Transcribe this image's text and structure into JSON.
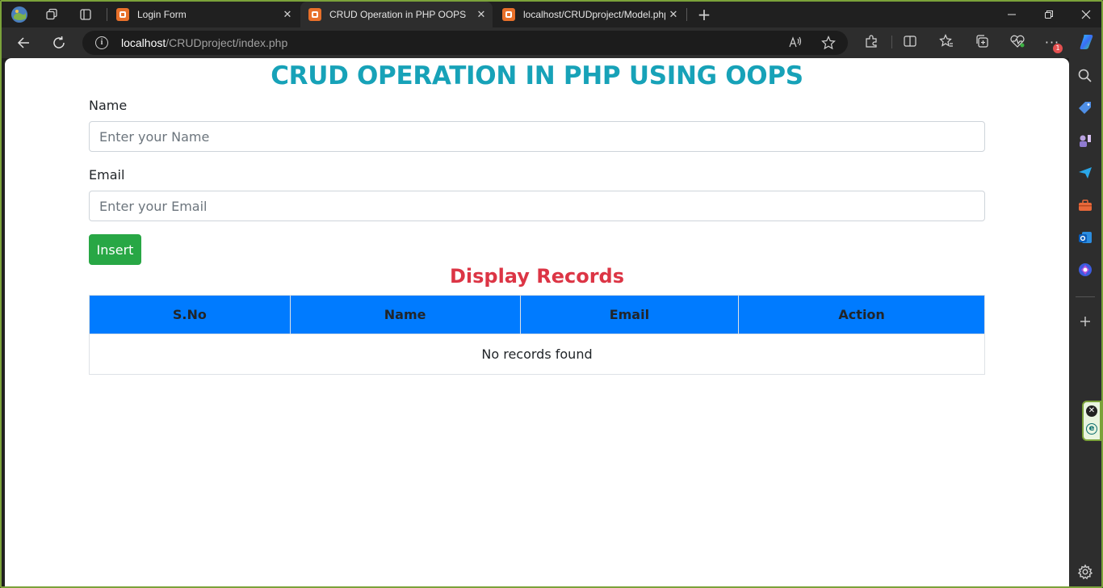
{
  "browser": {
    "tabs": [
      {
        "label": "Login Form",
        "active": false
      },
      {
        "label": "CRUD Operation in PHP OOPS",
        "active": true
      },
      {
        "label": "localhost/CRUDproject/Model.php",
        "active": false
      }
    ],
    "new_tab_label": "+",
    "url": {
      "host": "localhost",
      "path": "/CRUDproject/index.php"
    },
    "icons": {
      "profile": "profile-icon",
      "workspaces": "workspaces-icon",
      "tab_actions": "tab-actions-icon",
      "back": "back-arrow-icon",
      "refresh": "refresh-icon",
      "info": "site-info-icon",
      "read_aloud": "read-aloud-icon",
      "favorite": "star-icon",
      "extensions": "extensions-icon",
      "split_screen": "split-screen-icon",
      "favorites": "favorites-icon",
      "collections": "collections-icon",
      "performance": "performance-icon",
      "more": "more-icon",
      "copilot": "copilot-icon"
    },
    "notification_badge": "1"
  },
  "page": {
    "title": "CRUD OPERATION IN PHP USING OOPS",
    "form": {
      "name_label": "Name",
      "name_placeholder": "Enter your Name",
      "name_value": "",
      "email_label": "Email",
      "email_placeholder": "Enter your Email",
      "email_value": "",
      "insert_label": "Insert"
    },
    "records_title": "Display Records",
    "table": {
      "headers": [
        "S.No",
        "Name",
        "Email",
        "Action"
      ],
      "empty_message": "No records found"
    }
  },
  "colors": {
    "title": "#17a2b8",
    "records_title": "#dc3545",
    "insert_button": "#28a745",
    "table_header": "#007bff"
  }
}
